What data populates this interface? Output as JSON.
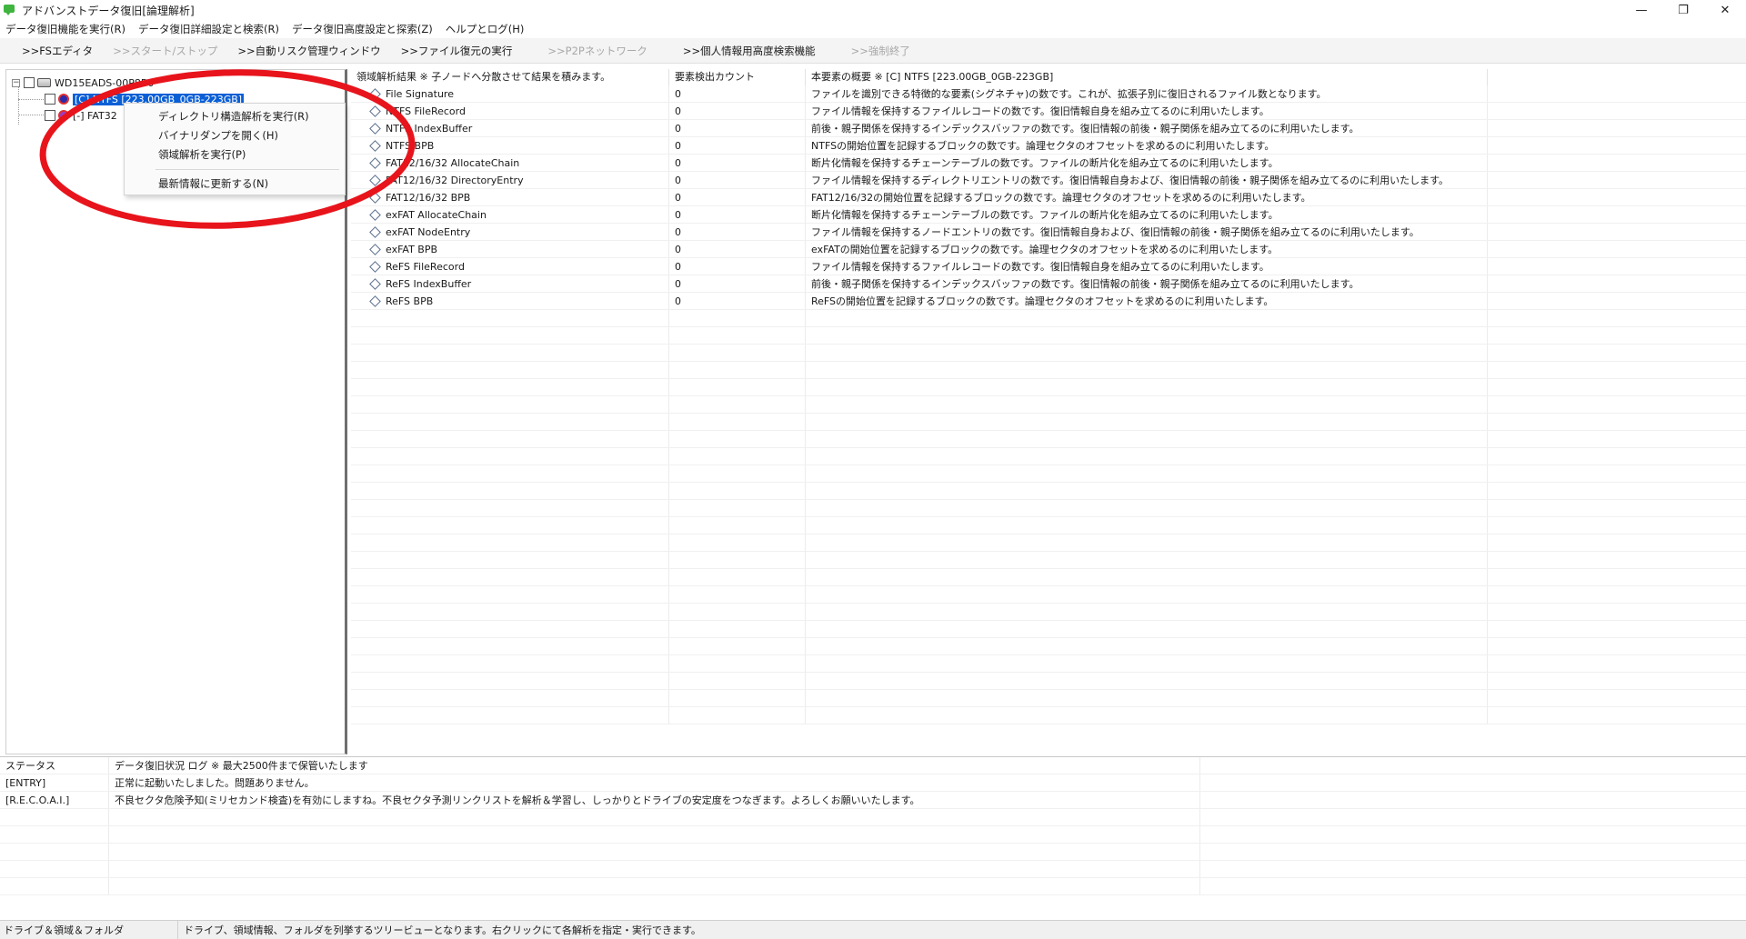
{
  "window": {
    "title": "アドバンストデータ復旧[論理解析]",
    "controls": {
      "minimize": "—",
      "maximize": "❐",
      "close": "✕"
    }
  },
  "menubar": [
    "データ復旧機能を実行(R)",
    "データ復旧詳細設定と検索(R)",
    "データ復旧高度設定と探索(Z)",
    "ヘルプとログ(H)"
  ],
  "toolbar": [
    {
      "label": ">>FSエディタ",
      "enabled": true
    },
    {
      "label": ">>スタート/ストップ",
      "enabled": false
    },
    {
      "label": ">>自動リスク管理ウィンドウ",
      "enabled": true
    },
    {
      "label": ">>ファイル復元の実行",
      "enabled": true
    },
    {
      "label": ">>P2Pネットワーク",
      "enabled": false
    },
    {
      "label": ">>個人情報用高度検索機能",
      "enabled": true
    },
    {
      "label": ">>強制終了",
      "enabled": false
    }
  ],
  "tree": {
    "root": {
      "label": "WD15EADS-00P8B0",
      "expander": "−"
    },
    "children": [
      {
        "label": "[C] NTFS [223.00GB_0GB-223GB]",
        "selected": true
      },
      {
        "label": "[-] FAT32",
        "selected": false
      }
    ]
  },
  "context_menu": {
    "items": [
      "ディレクトリ構造解析を実行(R)",
      "バイナリダンプを開く(H)",
      "領域解析を実行(P)"
    ],
    "after_separator": "最新情報に更新する(N)"
  },
  "list": {
    "headers": [
      "領域解析結果 ※ 子ノードへ分散させて結果を積みます。",
      "要素検出カウント",
      "本要素の概要 ※ [C] NTFS [223.00GB_0GB-223GB]",
      ""
    ],
    "rows": [
      {
        "name": "File Signature",
        "count": "0",
        "desc": "ファイルを識別できる特徴的な要素(シグネチャ)の数です。これが、拡張子別に復旧されるファイル数となります。"
      },
      {
        "name": "NTFS FileRecord",
        "count": "0",
        "desc": "ファイル情報を保持するファイルレコードの数です。復旧情報自身を組み立てるのに利用いたします。"
      },
      {
        "name": "NTFS IndexBuffer",
        "count": "0",
        "desc": "前後・親子関係を保持するインデックスバッファの数です。復旧情報の前後・親子関係を組み立てるのに利用いたします。"
      },
      {
        "name": "NTFS BPB",
        "count": "0",
        "desc": "NTFSの開始位置を記録するブロックの数です。論理セクタのオフセットを求めるのに利用いたします。"
      },
      {
        "name": "FAT12/16/32 AllocateChain",
        "count": "0",
        "desc": "断片化情報を保持するチェーンテーブルの数です。ファイルの断片化を組み立てるのに利用いたします。"
      },
      {
        "name": "FAT12/16/32 DirectoryEntry",
        "count": "0",
        "desc": "ファイル情報を保持するディレクトリエントリの数です。復旧情報自身および、復旧情報の前後・親子関係を組み立てるのに利用いたします。"
      },
      {
        "name": "FAT12/16/32 BPB",
        "count": "0",
        "desc": "FAT12/16/32の開始位置を記録するブロックの数です。論理セクタのオフセットを求めるのに利用いたします。"
      },
      {
        "name": "exFAT AllocateChain",
        "count": "0",
        "desc": "断片化情報を保持するチェーンテーブルの数です。ファイルの断片化を組み立てるのに利用いたします。"
      },
      {
        "name": "exFAT NodeEntry",
        "count": "0",
        "desc": "ファイル情報を保持するノードエントリの数です。復旧情報自身および、復旧情報の前後・親子関係を組み立てるのに利用いたします。"
      },
      {
        "name": "exFAT BPB",
        "count": "0",
        "desc": "exFATの開始位置を記録するブロックの数です。論理セクタのオフセットを求めるのに利用いたします。"
      },
      {
        "name": "ReFS FileRecord",
        "count": "0",
        "desc": "ファイル情報を保持するファイルレコードの数です。復旧情報自身を組み立てるのに利用いたします。"
      },
      {
        "name": "ReFS IndexBuffer",
        "count": "0",
        "desc": "前後・親子関係を保持するインデックスバッファの数です。復旧情報の前後・親子関係を組み立てるのに利用いたします。"
      },
      {
        "name": "ReFS BPB",
        "count": "0",
        "desc": "ReFSの開始位置を記録するブロックの数です。論理セクタのオフセットを求めるのに利用いたします。"
      }
    ]
  },
  "log": {
    "headers": [
      "ステータス",
      "データ復旧状況 ログ ※ 最大2500件まで保管いたします",
      ""
    ],
    "rows": [
      {
        "status": "[ENTRY]",
        "message": "正常に起動いたしました。問題ありません。"
      },
      {
        "status": "[R.E.C.O.A.I.]",
        "message": "不良セクタ危険予知(ミリセカンド検査)を有効にしますね。不良セクタ予測リンクリストを解析＆学習し、しっかりとドライブの安定度をつなぎます。よろしくお願いいたします。"
      }
    ]
  },
  "statusbar": {
    "left": "ドライブ＆領域＆フォルダ",
    "right": "ドライブ、領域情報、フォルダを列挙するツリービューとなります。右クリックにて各解析を指定・実行できます。"
  },
  "colors": {
    "selection": "#0a5fd6",
    "annotation": "#e8141c",
    "pane_divider": "#6f6f6f"
  }
}
